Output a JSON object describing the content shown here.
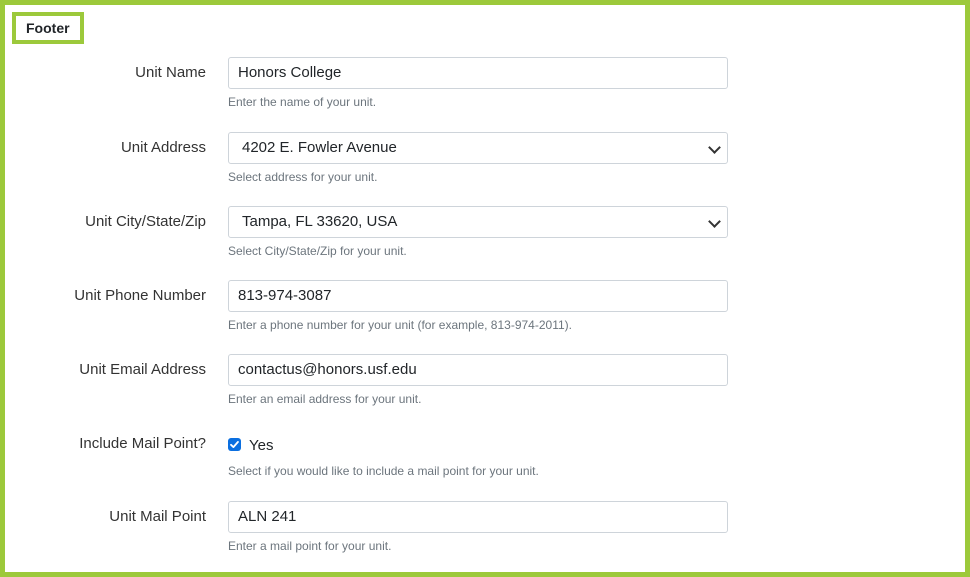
{
  "section": {
    "legend": "Footer"
  },
  "fields": [
    {
      "label": "Unit Name",
      "type": "text",
      "value": "Honors College",
      "help": "Enter the name of your unit."
    },
    {
      "label": "Unit Address",
      "type": "select",
      "value": "4202 E. Fowler Avenue",
      "help": "Select address for your unit."
    },
    {
      "label": "Unit City/State/Zip",
      "type": "select",
      "value": "Tampa, FL 33620, USA",
      "help": "Select City/State/Zip for your unit."
    },
    {
      "label": "Unit Phone Number",
      "type": "text",
      "value": "813-974-3087",
      "help": "Enter a phone number for your unit (for example, 813-974-2011)."
    },
    {
      "label": "Unit Email Address",
      "type": "text",
      "value": "contactus@honors.usf.edu",
      "help": "Enter an email address for your unit."
    },
    {
      "label": "Include Mail Point?",
      "type": "checkbox",
      "checked": true,
      "value": "Yes",
      "help": "Select if you would like to include a mail point for your unit."
    },
    {
      "label": "Unit Mail Point",
      "type": "text",
      "value": "ALN 241",
      "help": "Enter a mail point for your unit."
    }
  ],
  "colors": {
    "accent": "#9cc93b",
    "checkbox": "#0b6fe0"
  }
}
